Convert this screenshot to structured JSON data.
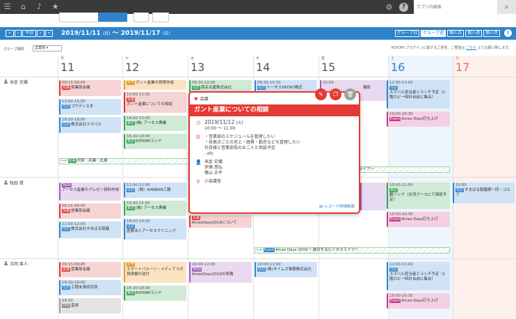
{
  "search": {
    "placeholder": "アプリ内検索"
  },
  "nav": {
    "first": "«",
    "prev": "‹",
    "today": "今日",
    "next": "›",
    "last": "»",
    "range": "2019/11/11",
    "range_wd1": "(月)",
    "range_sep": "〜",
    "range_end": "2019/11/17",
    "range_wd2": "(日)"
  },
  "views": [
    "グループ日",
    "グループ週",
    "個人日",
    "個人週",
    "個人月"
  ],
  "group_label": "グループ選択",
  "group_value": "営業部",
  "notice_pre": "KOYOMI プラグインに関するご意見、ご要望は",
  "notice_link": "こちら",
  "notice_post": "よりお願い致します。",
  "days": [
    {
      "wd": "月",
      "d": "11"
    },
    {
      "wd": "火",
      "d": "12"
    },
    {
      "wd": "水",
      "d": "13"
    },
    {
      "wd": "木",
      "d": "14"
    },
    {
      "wd": "金",
      "d": "15"
    },
    {
      "wd": "土",
      "d": "16"
    },
    {
      "wd": "日",
      "d": "17"
    }
  ],
  "people": [
    "米倉 史織",
    "牧田 賢",
    "玉岡 亜人"
  ],
  "events": {
    "r1": {
      "e1": {
        "time": "09:15-09:45",
        "tag": "会議",
        "text": "営業部会議"
      },
      "e2": {
        "time": "13:00-15:00",
        "tag": "往訪",
        "text": "コウディエ木"
      },
      "e3": {
        "time": "16:00-18:00",
        "tag": "往訪",
        "text": "株式会社スマバル"
      },
      "e4": {
        "tag": "メモ",
        "text": "ガント産業の見積作成"
      },
      "e5": {
        "time": "10:00-11:00",
        "tag": "会議",
        "text": "ガント産業についての相談"
      },
      "e6": {
        "time": "14:00-15:00",
        "tag": "来訪",
        "text": "(株) アーセス興業"
      },
      "e7": {
        "time": "16:30-18:00",
        "tag": "来訪",
        "text": "KOYOMIランド"
      },
      "e8": {
        "time": "08:30-10:30",
        "tag": "往訪",
        "text": "南名古屋株式会社"
      },
      "e9": {
        "time": "08:30-10:30",
        "tag": "往訪",
        "text": "トータスSKYNO株式"
      },
      "e10": {
        "time": "15:00",
        "text": "撮影"
      },
      "e11": {
        "time": "12:00-13:00",
        "tag": "往訪",
        "text": "スマバル担当者とランチ予定（1階ロビー時計台前に集合）"
      },
      "e12": {
        "time": "19:00-20:30",
        "tag": "Event",
        "text": "Arces Days打ち上げ"
      },
      "span1": {
        "tag": "出張",
        "text": "大阪・兵庫・広島"
      },
      "span2": {
        "text": "ライフ〜"
      }
    },
    "r2": {
      "e1": {
        "tag": "ToDo",
        "text": "アーセス産業のプレゼン資料作成"
      },
      "e2": {
        "time": "09:15-09:45",
        "tag": "会議",
        "text": "営業部会議"
      },
      "e3": {
        "time": "11:00-12:00",
        "tag": "往訪",
        "text": "株式会社すまばる製麺"
      },
      "e4": {
        "time": "11:00-12:00",
        "tag": "往訪",
        "text": "（株）KANBAN工務"
      },
      "e5": {
        "time": "14:00-15:00",
        "tag": "来訪",
        "text": "(株) アーセス興業"
      },
      "e6": {
        "time": "18:00-19:00",
        "tag": "往訪",
        "text": "医療法人アーセスクリニック"
      },
      "e7": {
        "tag": "会議",
        "text": "ArcesDays2019について"
      },
      "e8": {
        "time": "10:00-11:00",
        "tag": "来訪",
        "text": "鶴リンク（交流ブースにて面談予定）"
      },
      "e9": {
        "time": "19:00-20:30",
        "tag": "Event",
        "text": "Arces Days打ち上げ"
      },
      "e10": {
        "time": "10:00",
        "tag": "往訪",
        "text": "すまばる製麺様一同・ゴルフ"
      },
      "span": {
        "tag": "Event",
        "text": "Arces Days 2019 〜進化するビジネスライフ〜"
      }
    },
    "r3": {
      "e1": {
        "time": "09:15-09:45",
        "tag": "会議",
        "text": "営業部会議"
      },
      "e2": {
        "time": "16:30-18:00",
        "tag": "往訪",
        "text": "工程未来研究所"
      },
      "e3": {
        "time": "18:00",
        "tag": "外出",
        "text": "直帰"
      },
      "e4": {
        "tag": "メモ",
        "text": "スマートバルーン・メディアラボ 見積書の送付"
      },
      "e5": {
        "time": "16:30-18:00",
        "tag": "来訪",
        "text": "KOYOMIランド"
      },
      "e6": {
        "time": "09:00-12:00",
        "tag": "ToDo",
        "text": "ArcesDays2019の準備"
      },
      "e7": {
        "time": "10:00-11:00",
        "tag": "往訪",
        "text": "(株)タイムズ事務株式会社"
      },
      "e8": {
        "time": "12:00-13:00",
        "tag": "往訪",
        "text": "スマバル担当者とランチ予定（1階ロビー時計台前に集合）"
      },
      "e9": {
        "time": "19:00-20:30",
        "tag": "Event",
        "text": "Arces Days打ち上げ"
      }
    }
  },
  "popup": {
    "category": "会議",
    "title": "ガント産業についての相談",
    "date": "2019/11/12",
    "date_wd": "(火)",
    "time": "10:00 〜 11:00",
    "desc": [
      "・営業部のスケジュールを管理したい",
      "・各拠点ごとの売上・経費・勤怠なども管理したい",
      "社長様と営業部長のお二人と商談予定",
      "..etc"
    ],
    "attendees": [
      "米倉 史織",
      "伊達 悠弘",
      "葉山 正平"
    ],
    "place": "小会議室",
    "link": "レコード詳細画面"
  },
  "colors": {
    "brand": "#2f83c9",
    "accent": "#e53935",
    "topbar": "#3a3a3a"
  }
}
